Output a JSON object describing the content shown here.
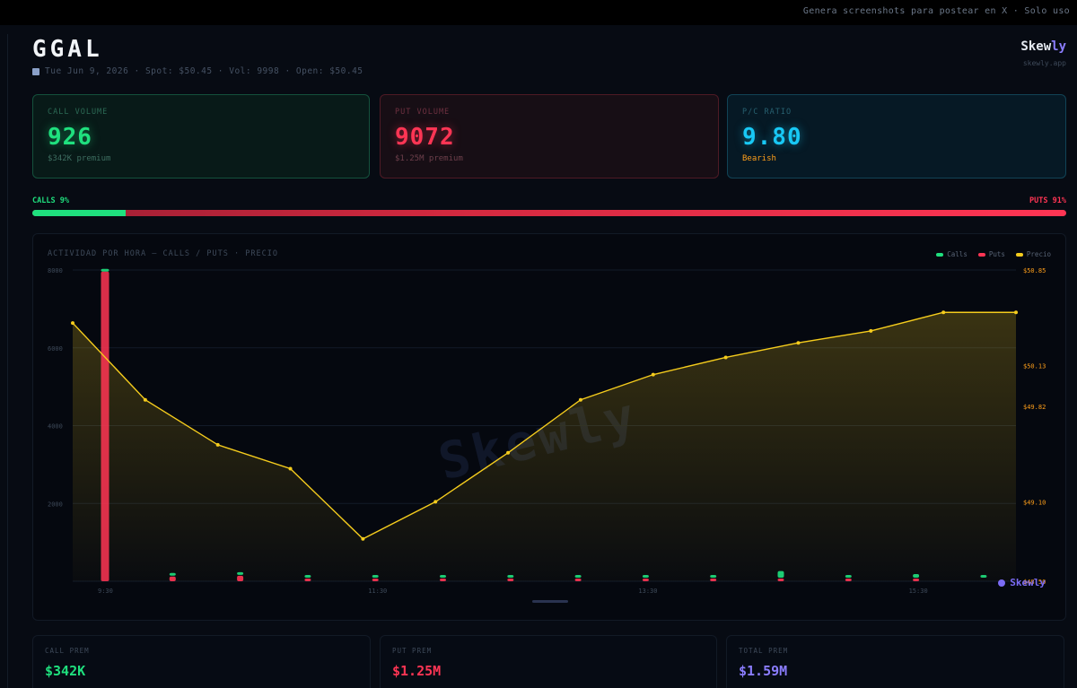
{
  "topbar": {
    "text": "Genera screenshots para postear en X · Solo uso"
  },
  "header": {
    "ticker": "GGAL",
    "meta": "Tue Jun 9, 2026 · Spot: $50.45 · Vol: 9998 · Open: $50.45",
    "calendar_icon": "calendar-icon"
  },
  "brand": {
    "name_main": "Skew",
    "name_accent": "ly",
    "url": "skewly.app"
  },
  "cards": {
    "call": {
      "label": "CALL VOLUME",
      "value": "926",
      "sub": "$342K premium"
    },
    "put": {
      "label": "PUT VOLUME",
      "value": "9072",
      "sub": "$1.25M premium"
    },
    "pc": {
      "label": "P/C RATIO",
      "value": "9.80",
      "sub": "Bearish"
    }
  },
  "ratio": {
    "calls_label": "CALLS 9%",
    "puts_label": "PUTS 91%",
    "calls_fraction": 0.09
  },
  "chart": {
    "title": "ACTIVIDAD POR HORA — CALLS / PUTS · PRECIO",
    "legend": [
      {
        "label": "Calls",
        "color": "#1fe07e"
      },
      {
        "label": "Puts",
        "color": "#ff3554"
      },
      {
        "label": "Precio",
        "color": "#f5cc1d"
      }
    ],
    "watermark": "Skewly",
    "brand": "Skewly"
  },
  "chart_data": {
    "type": "bar",
    "title": "ACTIVIDAD POR HORA — CALLS / PUTS · PRECIO",
    "x_tick_labels": [
      "9:30",
      "11:30",
      "13:30",
      "15:30"
    ],
    "y_left": {
      "ticks": [
        "8000",
        "6000",
        "4000",
        "2000"
      ],
      "ylim": [
        0,
        8000
      ]
    },
    "y_right": {
      "ticks": [
        "$50.85",
        "$50.13",
        "$49.82",
        "$49.10",
        "$48.50"
      ],
      "ylim": [
        48.5,
        50.85
      ]
    },
    "intervals": 14,
    "series": [
      {
        "name": "Calls",
        "color": "#1fe07e",
        "values": [
          40,
          20,
          15,
          5,
          10,
          5,
          8,
          5,
          5,
          5,
          170,
          60,
          90,
          20
        ]
      },
      {
        "name": "Puts",
        "color": "#ff3554",
        "values": [
          7960,
          120,
          140,
          60,
          50,
          60,
          50,
          40,
          60,
          40,
          70,
          60,
          70,
          0
        ]
      },
      {
        "name": "Precio",
        "color": "#f5cc1d",
        "values": [
          50.45,
          49.87,
          49.53,
          49.35,
          48.82,
          49.1,
          49.47,
          49.87,
          50.06,
          50.19,
          50.3,
          50.39,
          50.53,
          50.53
        ]
      }
    ],
    "grid": true,
    "legend_position": "top-right"
  },
  "bottom_cards": [
    {
      "label": "CALL PREM",
      "value": "$342K",
      "color": "#1fe07e"
    },
    {
      "label": "PUT PREM",
      "value": "$1.25M",
      "color": "#ff3554"
    },
    {
      "label": "TOTAL PREM",
      "value": "$1.59M",
      "color": "#8b7dff"
    }
  ]
}
